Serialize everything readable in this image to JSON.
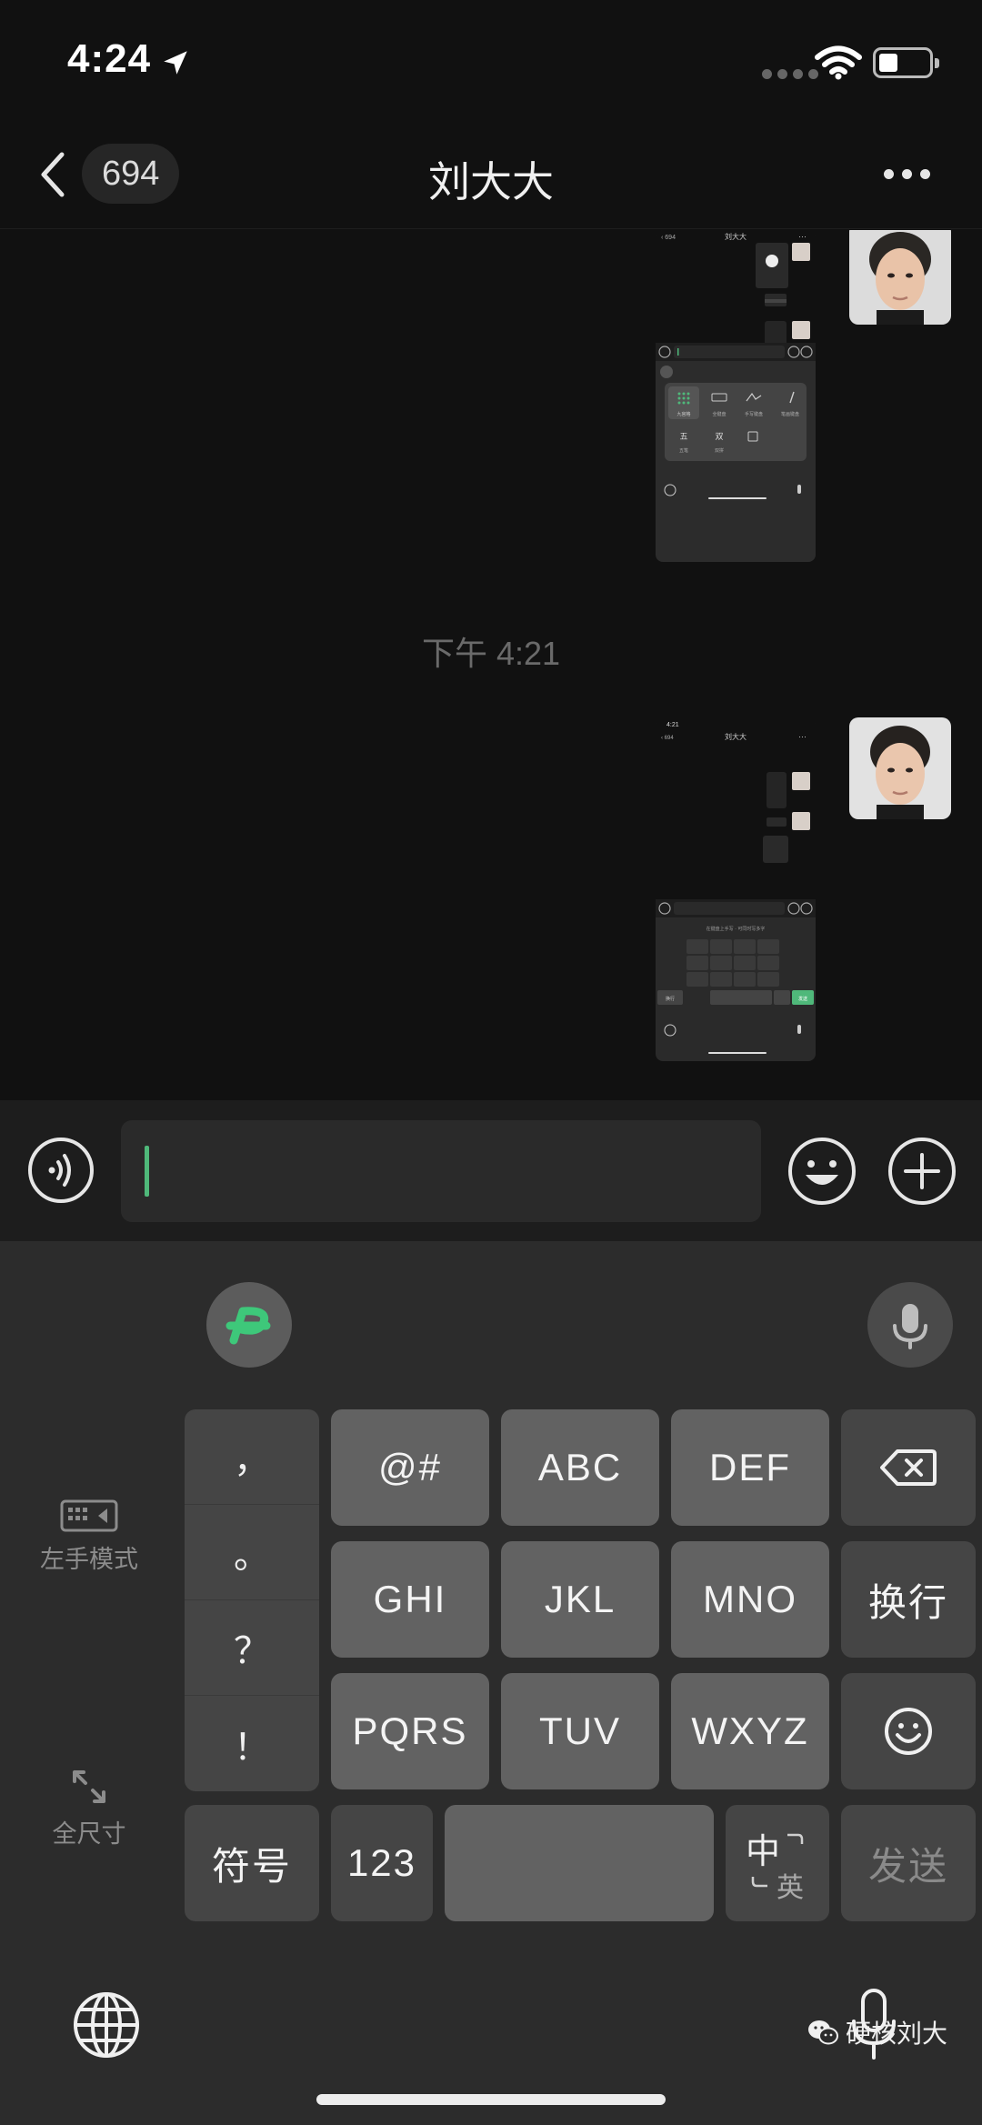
{
  "status_bar": {
    "time": "4:24"
  },
  "nav": {
    "unread_count": "694",
    "title": "刘大大"
  },
  "chat": {
    "timestamp": "下午 4:21",
    "thumb1": {
      "title": "刘大大",
      "badge": "694",
      "menu_items": [
        "九宫格",
        "全键盘",
        "手写键盘",
        "笔画键盘",
        "五笔",
        "双拼"
      ]
    },
    "thumb2": {
      "time": "4:21",
      "title": "刘大大",
      "badge": "694",
      "hint": "在键盘上手写 · 可同时写多字",
      "return_label": "换行",
      "send_label": "发送"
    }
  },
  "keyboard": {
    "left_hand_mode_label": "左手模式",
    "full_size_label": "全尺寸",
    "punctuation": [
      "，",
      "。",
      "？",
      "！"
    ],
    "rows": [
      [
        "@#",
        "ABC",
        "DEF"
      ],
      [
        "GHI",
        "JKL",
        "MNO"
      ],
      [
        "PQRS",
        "TUV",
        "WXYZ"
      ]
    ],
    "return_key": "换行",
    "symbols_key": "符号",
    "numbers_key": "123",
    "lang_key_zh": "中",
    "lang_key_en": "英",
    "send_key": "发送"
  },
  "watermark": "硬核刘大",
  "colors": {
    "accent_green": "#4fb87a",
    "background": "#111111",
    "keyboard_bg": "#2c2c2c",
    "key_bg": "#626262"
  }
}
